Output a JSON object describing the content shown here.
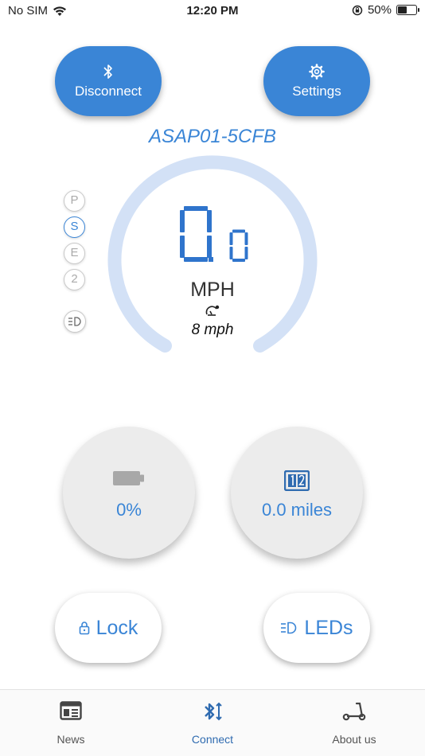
{
  "status_bar": {
    "carrier": "No SIM",
    "time": "12:20 PM",
    "battery_percent": "50%",
    "battery_level": 0.5
  },
  "header": {
    "disconnect_label": "Disconnect",
    "settings_label": "Settings",
    "device_name": "ASAP01-5CFB"
  },
  "modes": {
    "items": [
      "P",
      "S",
      "E",
      "2"
    ],
    "active": "S"
  },
  "speedometer": {
    "speed_integer": "0",
    "speed_decimal": "0",
    "unit": "MPH",
    "speed_limit": "8 mph",
    "arc_color": "#d3e1f6"
  },
  "stats": {
    "battery_value": "0%",
    "distance_value": "0.0 miles"
  },
  "actions": {
    "lock_label": "Lock",
    "leds_label": "LEDs"
  },
  "tabs": [
    {
      "label": "News",
      "icon": "news-icon",
      "active": false
    },
    {
      "label": "Connect",
      "icon": "bluetooth-connect-icon",
      "active": true
    },
    {
      "label": "About us",
      "icon": "scooter-icon",
      "active": false
    }
  ],
  "colors": {
    "accent": "#3a85d6",
    "gauge_track": "#d3e1f6",
    "circle_bg": "#ececec"
  }
}
